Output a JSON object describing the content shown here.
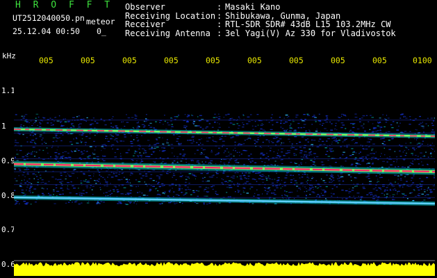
{
  "header": {
    "brand": "H R O F F T",
    "filename": "UT2512040050.pn",
    "mode": "meteor",
    "timestamp": "25.12.04 00:50",
    "zero_label": "0_",
    "info": [
      {
        "key": "Observer",
        "sep": ":",
        "value": "Masaki Kano"
      },
      {
        "key": "Receiving Location",
        "sep": ":",
        "value": "Shibukawa, Gunma, Japan"
      },
      {
        "key": "Receiver",
        "sep": ":",
        "value": "RTL-SDR SDR# 43dB L15 103.2MHz CW"
      },
      {
        "key": "Receiving Antenna",
        "sep": ":",
        "value": "3el Yagi(V) Az 330 for Vladivostok"
      }
    ]
  },
  "axis": {
    "unit": "kHz",
    "y_ticks": [
      "1.1",
      "1",
      "0.9",
      "0.8",
      "0.7",
      "0.6"
    ],
    "time_ticks": [
      "005",
      "005",
      "005",
      "005",
      "005",
      "005",
      "005",
      "005",
      "005",
      "0100"
    ]
  },
  "colors": {
    "background": "#000000",
    "brand": "#3ee23e",
    "time_labels": "#e8e800",
    "noise": "#1430c8",
    "signal": "#ff2a6a",
    "meteor_bar": "#ffff00"
  },
  "chart_data": {
    "type": "heatmap",
    "ylabel": "kHz",
    "ylim": [
      0.6,
      1.12
    ],
    "time_ticks": [
      "005",
      "005",
      "005",
      "005",
      "005",
      "005",
      "005",
      "005",
      "005",
      "0100"
    ],
    "band_limits_khz": [
      0.775,
      1.035
    ],
    "carriers": [
      {
        "start_khz": 0.99,
        "end_khz": 0.97
      },
      {
        "start_khz": 0.89,
        "end_khz": 0.868
      },
      {
        "start_khz": 0.794,
        "end_khz": 0.776
      }
    ],
    "meteor_activity_bar_khz": 0.6
  }
}
